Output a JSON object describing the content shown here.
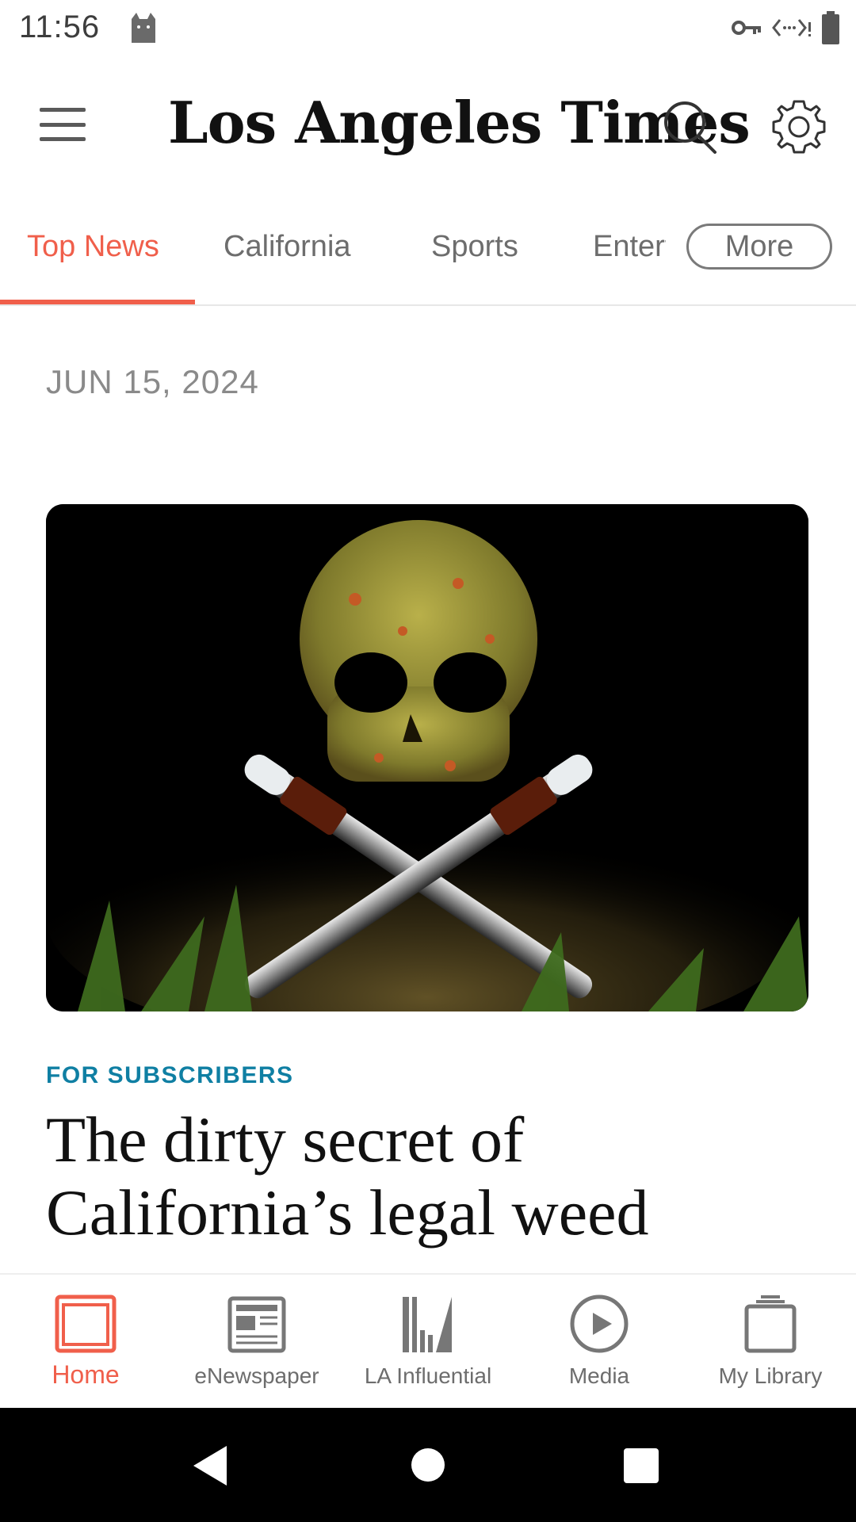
{
  "status_bar": {
    "time": "11:56"
  },
  "header": {
    "masthead": "Los Angeles Times"
  },
  "tabs": {
    "items": [
      "Top News",
      "California",
      "Sports"
    ],
    "clipped": "Entertainment",
    "more_label": "More",
    "active_color": "#f05f4b"
  },
  "content": {
    "date": "JUN 15, 2024",
    "kicker": "FOR SUBSCRIBERS",
    "headline": "The dirty secret of California’s legal weed",
    "kicker_color": "#0f7fa3"
  },
  "bottom_nav": {
    "items": [
      {
        "label": "Home",
        "icon": "home-icon"
      },
      {
        "label": "eNewspaper",
        "icon": "newspaper-icon"
      },
      {
        "label": "LA Influential",
        "icon": "influential-icon"
      },
      {
        "label": "Media",
        "icon": "play-icon"
      },
      {
        "label": "My Library",
        "icon": "library-icon"
      }
    ]
  }
}
